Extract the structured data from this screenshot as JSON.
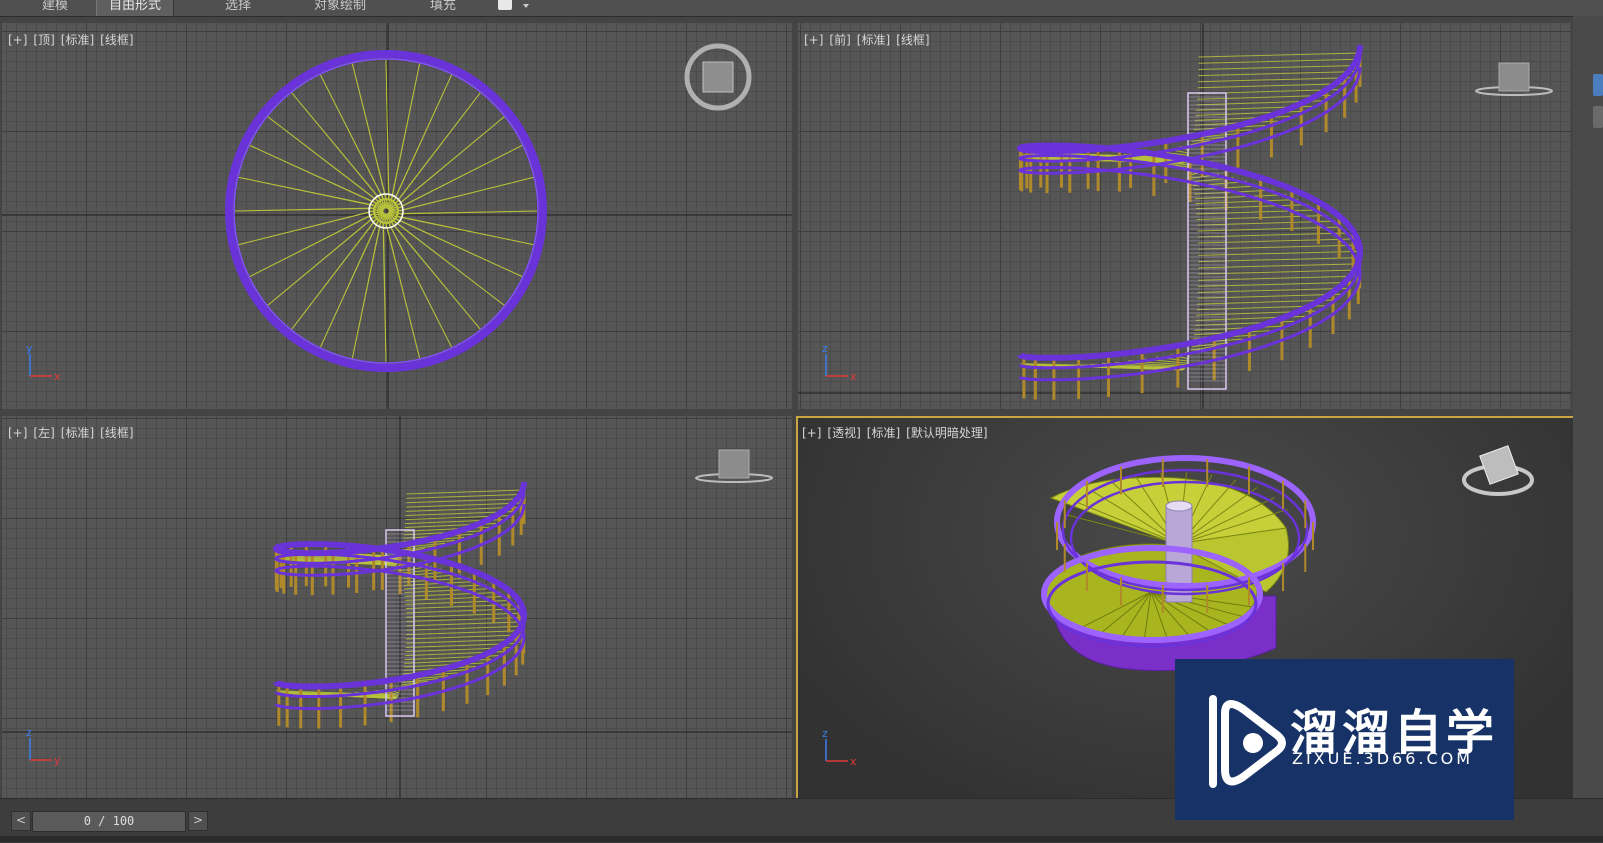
{
  "ribbon": {
    "tabs": [
      {
        "label": "建模",
        "active": false
      },
      {
        "label": "自由形式",
        "active": true
      },
      {
        "label": "选择",
        "active": false
      },
      {
        "label": "对象绘制",
        "active": false
      },
      {
        "label": "填充",
        "active": false
      }
    ]
  },
  "viewports": {
    "top": {
      "labels": [
        "[+]",
        "[顶]",
        "[标准]",
        "[线框]"
      ],
      "gizmo": "viewcube-top-icon"
    },
    "front": {
      "labels": [
        "[+]",
        "[前]",
        "[标准]",
        "[线框]"
      ],
      "gizmo": "viewcube-front-icon"
    },
    "left": {
      "labels": [
        "[+]",
        "[左]",
        "[标准]",
        "[线框]"
      ],
      "gizmo": "viewcube-left-icon"
    },
    "perspective": {
      "labels": [
        "[+]",
        "[透视]",
        "[标准]",
        "[默认明暗处理]"
      ],
      "gizmo": "viewcube-perspective-icon",
      "active": true
    }
  },
  "axes": {
    "x": "x",
    "y": "y",
    "z": "z"
  },
  "timeline": {
    "frame_display": "0 / 100",
    "prev": "<",
    "next": ">"
  },
  "watermark": {
    "title": "溜溜自学",
    "url": "ZIXUE.3D66.COM"
  },
  "colors": {
    "railing": "#6a32d9",
    "steps": "#b8c23a",
    "posts": "#b08a2a",
    "column": "#d9c8f0",
    "active_border": "#c8a641",
    "watermark_bg": "#173266"
  }
}
